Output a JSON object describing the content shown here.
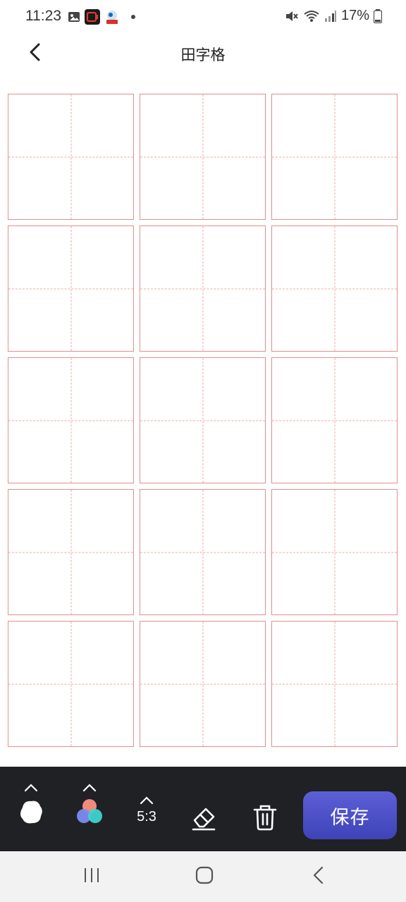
{
  "status_bar": {
    "time": "11:23",
    "battery_percent": "17%",
    "icons": [
      "gallery-icon",
      "screen-recorder-icon",
      "app-notification-icon",
      "mute-icon",
      "wifi-icon",
      "signal-icon",
      "battery-icon"
    ]
  },
  "header": {
    "title": "田字格",
    "back_icon": "chevron-left-icon"
  },
  "grid": {
    "rows": 5,
    "columns": 3,
    "line_color": "#e0908a"
  },
  "toolbar": {
    "brush_icon": "brush-shape-icon",
    "color_icon": "color-palette-icon",
    "ratio_label": "5:3",
    "eraser_icon": "eraser-icon",
    "delete_icon": "trash-icon",
    "save_label": "保存",
    "accent_color": "#4b4fc4"
  },
  "nav_bar": {
    "icons": [
      "recent-apps-icon",
      "home-icon",
      "back-icon"
    ]
  }
}
